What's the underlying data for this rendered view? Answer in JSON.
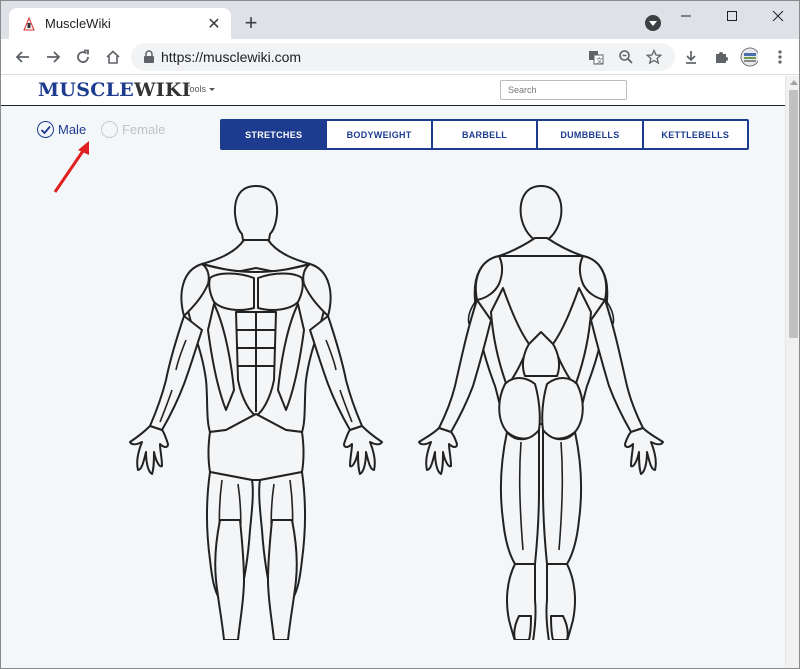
{
  "browser": {
    "tab_title": "MuscleWiki",
    "url": "https://musclewiki.com"
  },
  "site": {
    "logo_part1": "MUSCLE",
    "logo_part2": "WIKI",
    "tools_label": "Tools",
    "search_placeholder": "Search"
  },
  "gender": {
    "male_label": "Male",
    "female_label": "Female",
    "selected": "male"
  },
  "categories": [
    {
      "label": "STRETCHES",
      "active": true
    },
    {
      "label": "BODYWEIGHT",
      "active": false
    },
    {
      "label": "BARBELL",
      "active": false
    },
    {
      "label": "DUMBBELLS",
      "active": false
    },
    {
      "label": "KETTLEBELLS",
      "active": false
    }
  ],
  "colors": {
    "brand_blue": "#1e3c8f",
    "page_bg": "#f4f7fa",
    "annotation_arrow": "#e02020"
  },
  "icons": {
    "annotation": "red-arrow-icon",
    "figures": [
      "front-body-figure",
      "back-body-figure"
    ]
  }
}
